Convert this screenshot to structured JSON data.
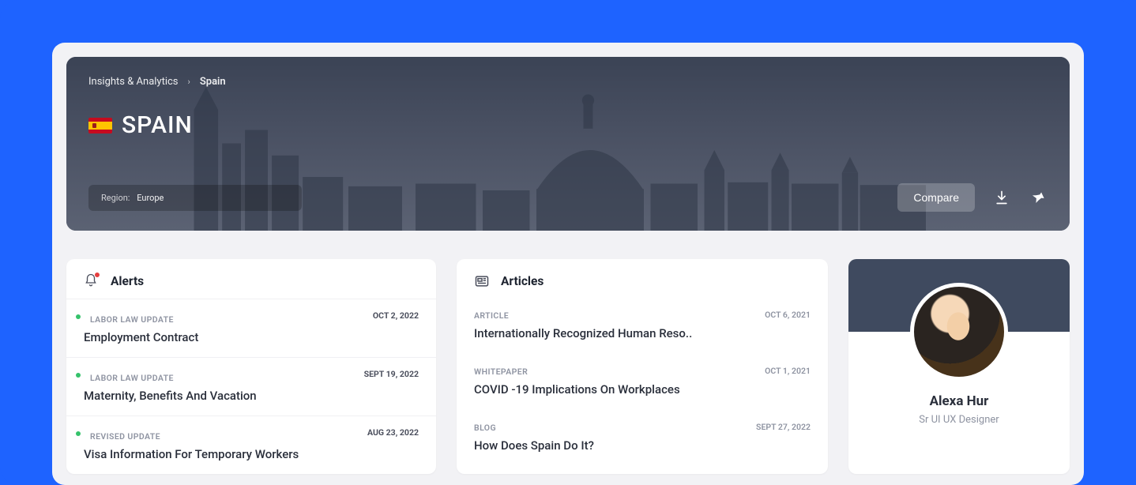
{
  "breadcrumb": {
    "root": "Insights & Analytics",
    "current": "Spain"
  },
  "page": {
    "title": "SPAIN",
    "region_label": "Region:",
    "region_value": "Europe"
  },
  "actions": {
    "compare": "Compare"
  },
  "alerts": {
    "heading": "Alerts",
    "items": [
      {
        "category": "LABOR LAW UPDATE",
        "date": "OCT 2, 2022",
        "title": "Employment Contract"
      },
      {
        "category": "LABOR LAW UPDATE",
        "date": "SEPT 19, 2022",
        "title": "Maternity, Benefits And Vacation"
      },
      {
        "category": "REVISED UPDATE",
        "date": "AUG 23, 2022",
        "title": "Visa Information For Temporary Workers"
      }
    ]
  },
  "articles": {
    "heading": "Articles",
    "items": [
      {
        "category": "ARTICLE",
        "date": "OCT 6, 2021",
        "title": "Internationally Recognized Human Reso.."
      },
      {
        "category": "WHITEPAPER",
        "date": "OCT 1, 2021",
        "title": "COVID -19 Implications On Workplaces"
      },
      {
        "category": "BLOG",
        "date": "SEPT 27, 2022",
        "title": "How Does Spain Do It?"
      }
    ]
  },
  "profile": {
    "name": "Alexa Hur",
    "role": "Sr UI UX Designer"
  }
}
